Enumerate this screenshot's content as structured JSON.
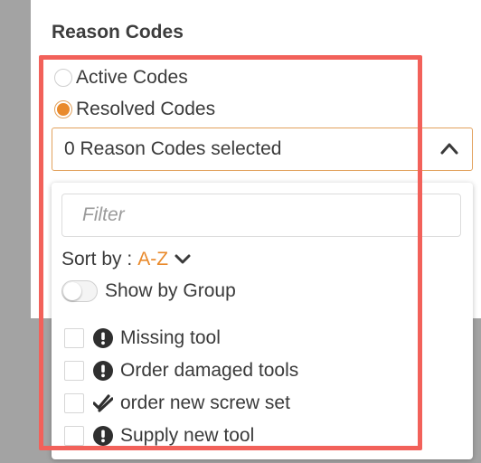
{
  "section": {
    "title": "Reason Codes"
  },
  "mode": {
    "options": [
      {
        "label": "Active Codes",
        "selected": false
      },
      {
        "label": "Resolved Codes",
        "selected": true
      }
    ]
  },
  "select": {
    "value": "0 Reason Codes selected"
  },
  "dropdown": {
    "filter_placeholder": "Filter",
    "sort_label": "Sort by :",
    "sort_value": "A-Z",
    "group_toggle_label": "Show by Group",
    "group_toggle_on": false,
    "items": [
      {
        "label": "Missing tool",
        "icon": "exclamation-circle-icon",
        "checked": false
      },
      {
        "label": "Order damaged tools",
        "icon": "exclamation-circle-icon",
        "checked": false
      },
      {
        "label": "order new screw set",
        "icon": "double-check-icon",
        "checked": false
      },
      {
        "label": "Supply new tool",
        "icon": "exclamation-circle-icon",
        "checked": false
      }
    ]
  },
  "colors": {
    "accent": "#e98a2c",
    "highlight": "#f2615a",
    "backdrop": "#a3a3a3"
  }
}
